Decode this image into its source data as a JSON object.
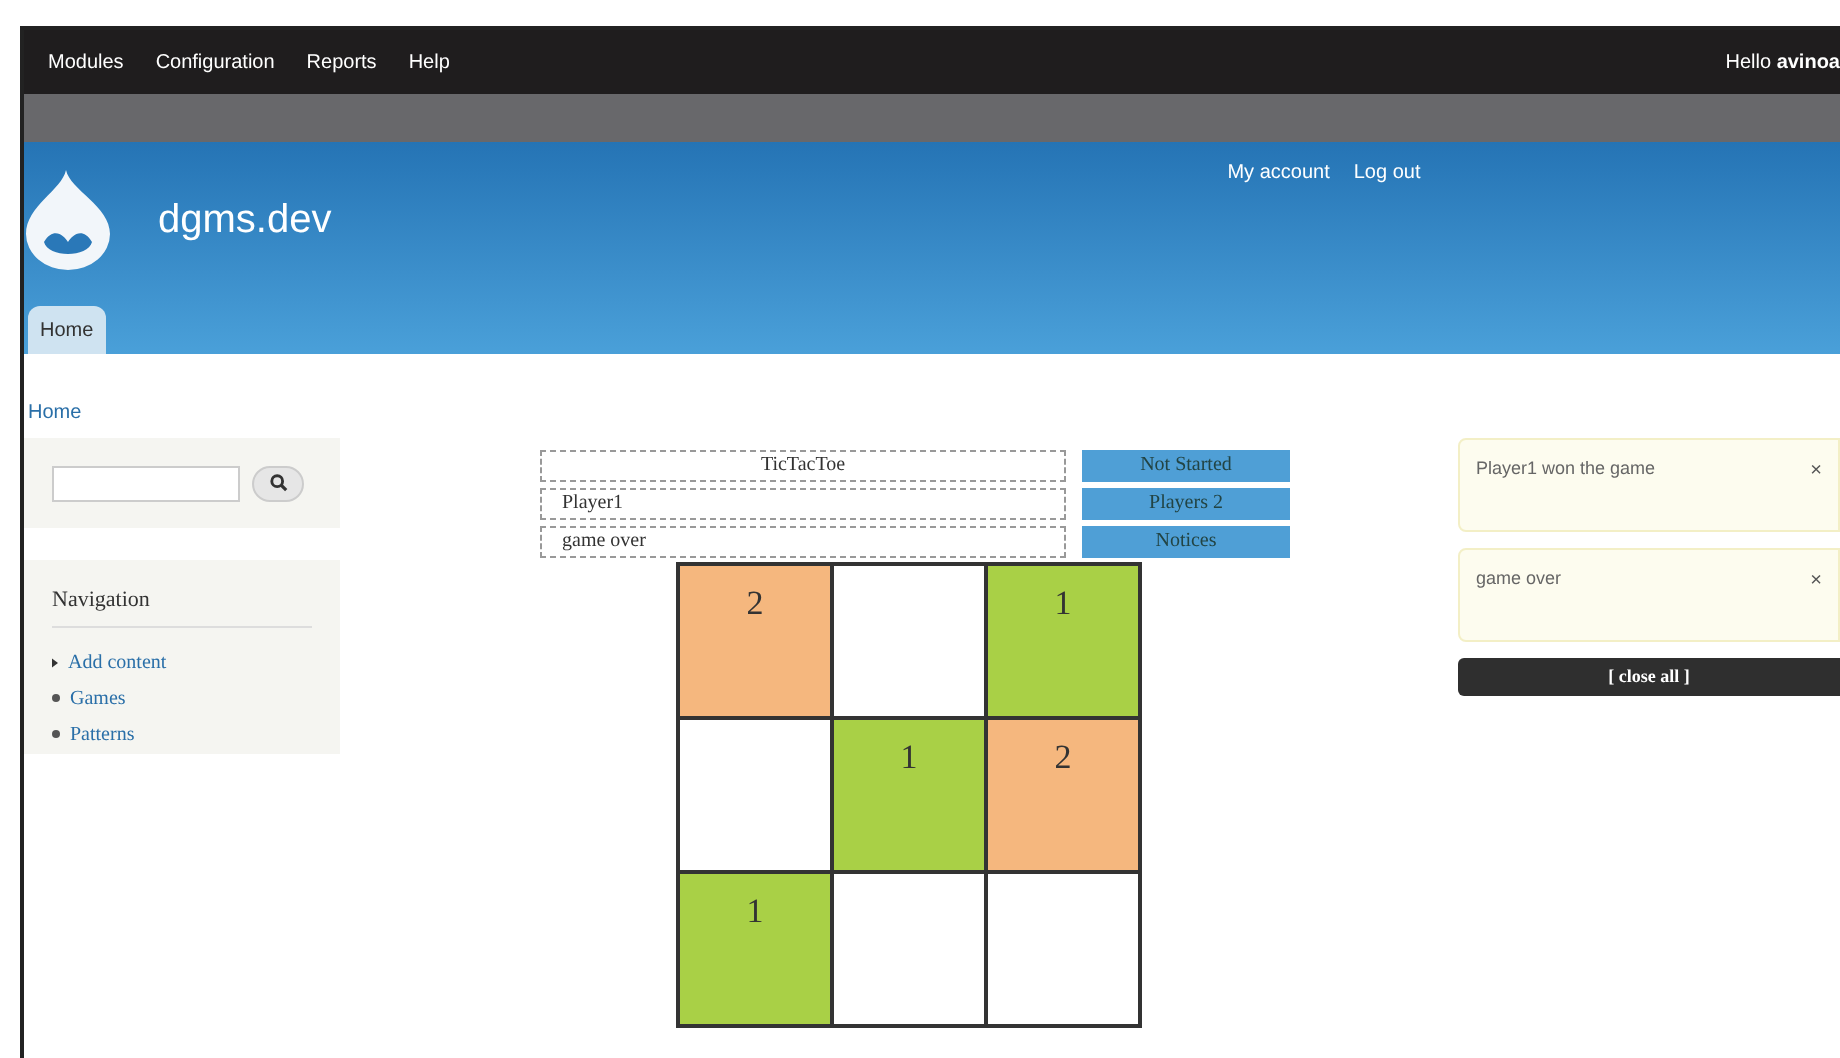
{
  "toolbar": {
    "menu": [
      "Modules",
      "Configuration",
      "Reports",
      "Help"
    ],
    "greeting": "Hello **avinoa**"
  },
  "header": {
    "site_name": "dgms.dev",
    "secondary_menu": [
      "My account",
      "Log out"
    ],
    "tabs": [
      {
        "label": "Home",
        "selected": true
      }
    ]
  },
  "breadcrumb": "Home",
  "sidebar": {
    "navigation": {
      "title": "Navigation",
      "items": [
        {
          "label": "Add content",
          "kind": "collapsed"
        },
        {
          "label": "Games",
          "kind": "leaf"
        },
        {
          "label": "Patterns",
          "kind": "leaf"
        }
      ]
    }
  },
  "game": {
    "info_rows": [
      {
        "text": "TicTacToe",
        "label": "Not Started",
        "kind": "title"
      },
      {
        "text": "Player1",
        "label": "Players 2",
        "kind": "field"
      },
      {
        "text": "game over",
        "label": "Notices",
        "kind": "field"
      }
    ],
    "board": [
      {
        "value": "2",
        "color": "#f5b77e"
      },
      {
        "color": "#ffffff"
      },
      {
        "value": "1",
        "color": "#a9d046"
      },
      {
        "color": "#ffffff"
      },
      {
        "value": "1",
        "color": "#a9d046"
      },
      {
        "value": "2",
        "color": "#f5b77e"
      },
      {
        "value": "1",
        "color": "#a9d046"
      },
      {
        "color": "#ffffff"
      },
      {
        "color": "#ffffff"
      }
    ]
  },
  "messages": {
    "items": [
      {
        "text": "Player1 won the game",
        "close": "×"
      },
      {
        "text": "game over",
        "close": "×"
      }
    ],
    "close_all": "[ close all ]"
  }
}
